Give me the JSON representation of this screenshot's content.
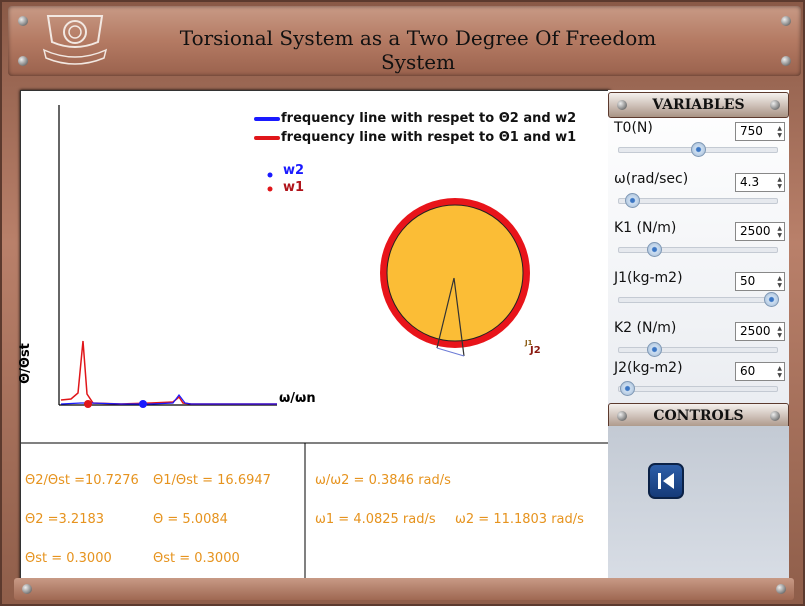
{
  "app": {
    "title": "Torsional System as a Two Degree Of Freedom System"
  },
  "graph": {
    "legend": {
      "blue_line": "frequency line with respet to  Θ2 and w2",
      "red_line": "frequency line with respet to Θ1   and w1",
      "w2": "w2",
      "w1": "w1"
    },
    "ylabel": "Θ/Θst",
    "xlabel": "ω/ωn",
    "disk_label_j1": "J1",
    "disk_label_j2": "J2",
    "colors": {
      "w2": "#1a1aff",
      "w1": "#e0161a",
      "disk_fill": "#fbbd36",
      "disk_rim": "#e8141a",
      "results": "#e6931e"
    }
  },
  "results": {
    "ratio2": "Θ2/Θst =10.7276",
    "ratio1": "Θ1/Θst = 16.6947",
    "freq_ratio": "ω/ω2 = 0.3846 rad/s",
    "theta2": "Θ2 =3.2183",
    "theta": "Θ = 5.0084",
    "w1": "ω1 = 4.0825 rad/s",
    "w2": "ω2 = 11.1803 rad/s",
    "theta_st_a": "Θst = 0.3000",
    "theta_st_b": "Θst = 0.3000"
  },
  "variables": {
    "header": "VARIABLES",
    "items": [
      {
        "label": "T0(N)",
        "value": "750",
        "level": 0.5
      },
      {
        "label": "ω(rad/sec)",
        "value": "4.3",
        "level": 0.08
      },
      {
        "label": "K1 (N/m)",
        "value": "2500",
        "level": 0.22
      },
      {
        "label": "J1(kg-m2)",
        "value": "50",
        "level": 0.96
      },
      {
        "label": "K2 (N/m)",
        "value": "2500",
        "level": 0.22
      },
      {
        "label": "J2(kg-m2)",
        "value": "60",
        "level": 0.05
      }
    ]
  },
  "controls": {
    "header": "CONTROLS",
    "back_icon": "step-back-icon"
  }
}
